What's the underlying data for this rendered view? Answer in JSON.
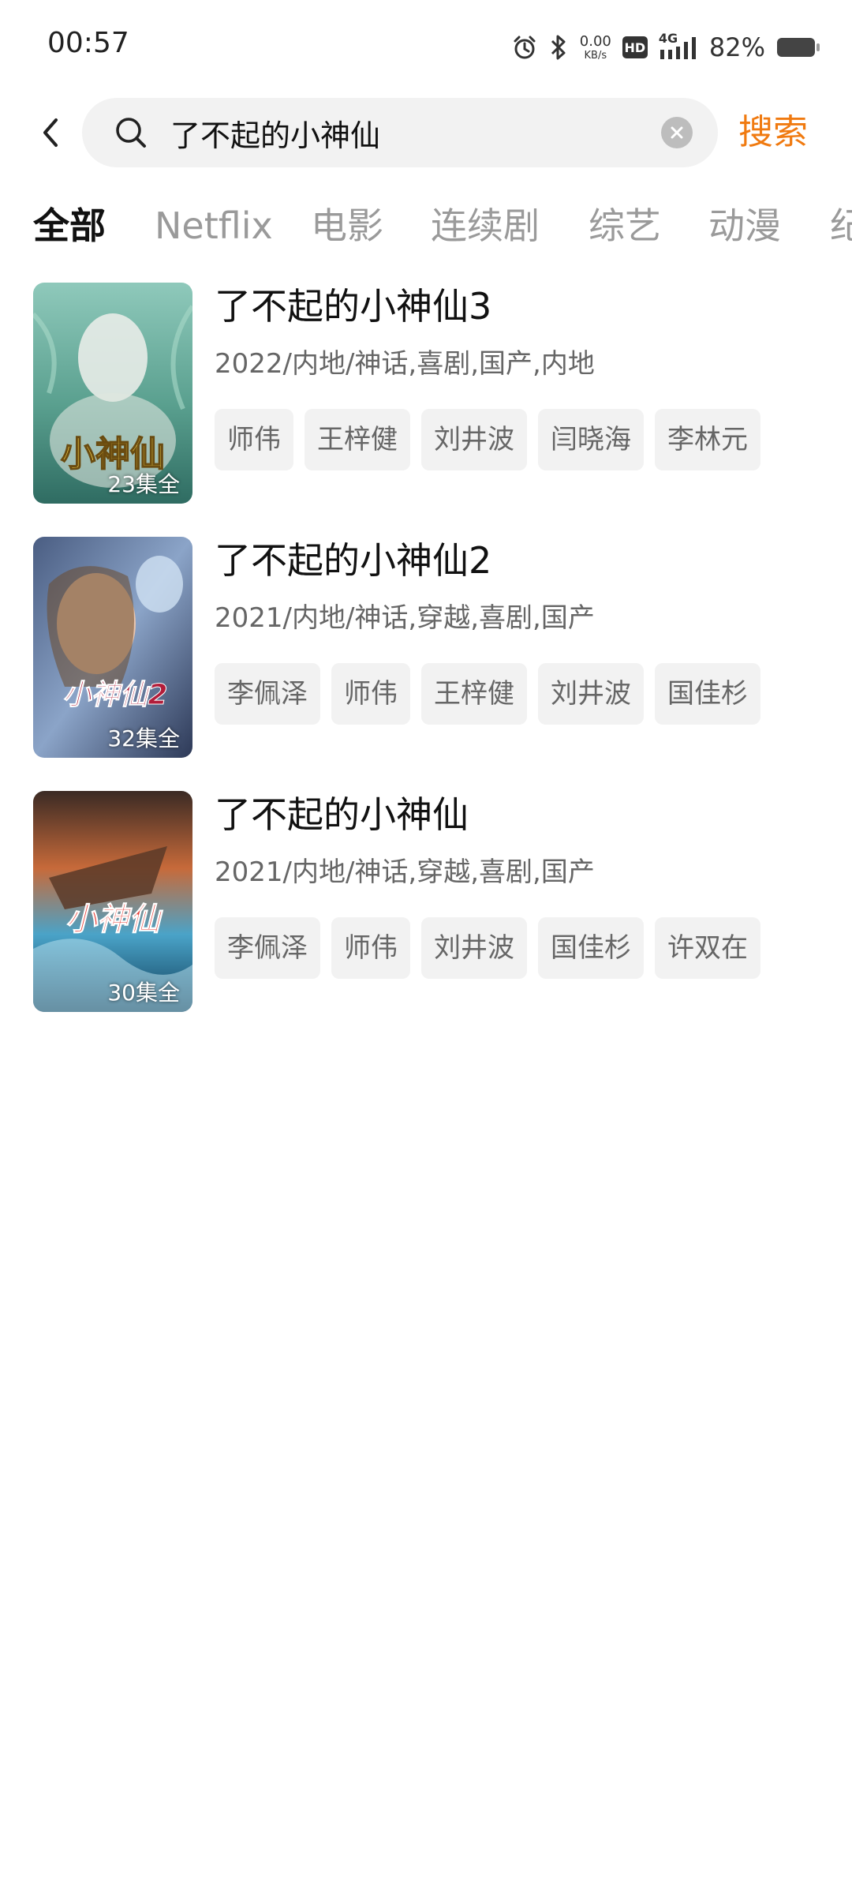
{
  "status_bar": {
    "time": "00:57",
    "net_speed_value": "0.00",
    "net_speed_unit": "KB/s",
    "hd_label": "HD",
    "signal_label": "4G",
    "battery_percent": "82%",
    "icons": [
      "alarm-icon",
      "bluetooth-icon",
      "hd-icon",
      "signal-4g-icon",
      "battery-icon"
    ]
  },
  "search": {
    "query": "了不起的小神仙",
    "button_label": "搜索",
    "accent_color": "#f07a10"
  },
  "tabs": [
    {
      "label": "全部",
      "active": true
    },
    {
      "label": "Netflix",
      "active": false
    },
    {
      "label": "电影",
      "active": false
    },
    {
      "label": "连续剧",
      "active": false
    },
    {
      "label": "综艺",
      "active": false
    },
    {
      "label": "动漫",
      "active": false
    },
    {
      "label": "纪",
      "active": false
    }
  ],
  "results": [
    {
      "title": "了不起的小神仙3",
      "meta": "2022/内地/神话,喜剧,国产,内地",
      "episodes": "23集全",
      "poster_text": "小神仙",
      "actors": [
        "师伟",
        "王梓健",
        "刘井波",
        "闫晓海",
        "李林元"
      ]
    },
    {
      "title": "了不起的小神仙2",
      "meta": "2021/内地/神话,穿越,喜剧,国产",
      "episodes": "32集全",
      "poster_text": "小神仙2",
      "actors": [
        "李佩泽",
        "师伟",
        "王梓健",
        "刘井波",
        "国佳杉"
      ]
    },
    {
      "title": "了不起的小神仙",
      "meta": "2021/内地/神话,穿越,喜剧,国产",
      "episodes": "30集全",
      "poster_text": "小神仙",
      "actors": [
        "李佩泽",
        "师伟",
        "刘井波",
        "国佳杉",
        "许双在"
      ]
    }
  ]
}
